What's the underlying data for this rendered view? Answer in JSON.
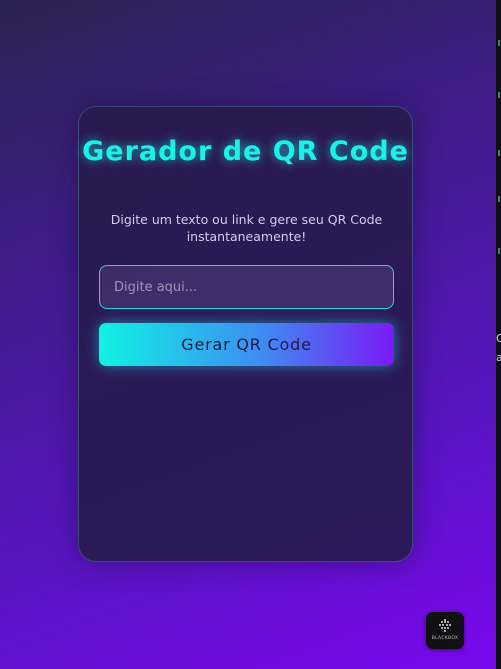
{
  "app": {
    "title": "Gerador de QR Code",
    "subtitle": "Digite um texto ou link e gere seu QR Code instantaneamente!"
  },
  "input": {
    "value": "",
    "placeholder": "Digite aqui..."
  },
  "button": {
    "label": "Gerar QR Code"
  },
  "badge": {
    "label": "BLACKBOX"
  },
  "edge": {
    "glyph_top": "O",
    "glyph_bottom": "a"
  },
  "colors": {
    "title": "#19f2e6",
    "input_border": "#1fd8e2",
    "button_start": "#10f2e3",
    "button_end": "#7a1af5",
    "card_bg": "#281a4e"
  },
  "icons": {
    "badge_icon": "blackbox-logo-icon"
  }
}
